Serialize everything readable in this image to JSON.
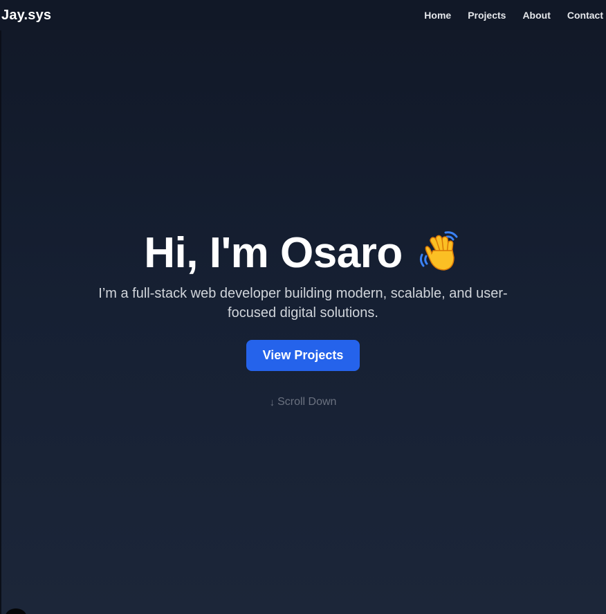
{
  "navbar": {
    "brand": "Jay.sys",
    "links": [
      {
        "label": "Home"
      },
      {
        "label": "Projects"
      },
      {
        "label": "About"
      },
      {
        "label": "Contact"
      }
    ]
  },
  "hero": {
    "title": "Hi, I'm Osaro",
    "title_icon": "waving-hand-icon",
    "subtitle": "I’m a full-stack web developer building modern, scalable, and user-focused digital solutions.",
    "cta_label": "View Projects",
    "scroll_label": "Scroll Down",
    "scroll_arrow": "↓"
  },
  "colors": {
    "background_top": "#111827",
    "background_bottom": "#1c2639",
    "accent": "#2563eb",
    "text_primary": "#ffffff",
    "text_muted": "#6b7280"
  }
}
